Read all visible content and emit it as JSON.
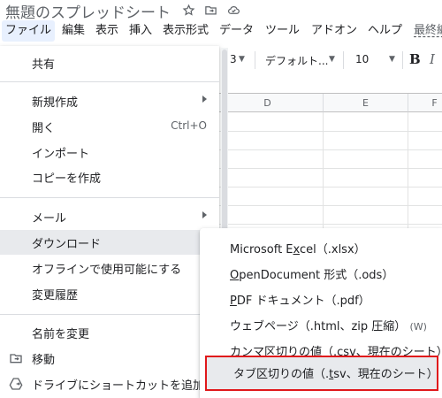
{
  "title": {
    "doc_title": "無題のスプレッドシート",
    "icons": [
      "star-icon",
      "move-folder-icon",
      "cloud-status-icon"
    ]
  },
  "menubar": {
    "items": [
      {
        "label": "ファイル",
        "active": true
      },
      {
        "label": "編集"
      },
      {
        "label": "表示"
      },
      {
        "label": "挿入"
      },
      {
        "label": "表示形式"
      },
      {
        "label": "データ"
      },
      {
        "label": "ツール"
      },
      {
        "label": "アドオン"
      },
      {
        "label": "ヘルプ"
      },
      {
        "label": "最終編"
      }
    ]
  },
  "toolbar": {
    "fragment": "3",
    "font": "デフォルト...",
    "font_size": "10",
    "bold": "B",
    "italic": "I"
  },
  "grid": {
    "columns": [
      "D",
      "E",
      "F"
    ]
  },
  "file_menu": {
    "items": [
      {
        "label": "共有"
      },
      {
        "label": "新規作成",
        "submenu": true
      },
      {
        "label": "開く",
        "shortcut": "Ctrl+O"
      },
      {
        "label": "インポート"
      },
      {
        "label": "コピーを作成"
      },
      {
        "label": "メール",
        "submenu": true
      },
      {
        "label": "ダウンロード",
        "submenu": true,
        "hover": true
      },
      {
        "label": "オフラインで使用可能にする"
      },
      {
        "label": "変更履歴",
        "submenu": true
      },
      {
        "label": "名前を変更"
      },
      {
        "label": "移動",
        "icon": "move-folder-icon"
      },
      {
        "label": "ドライブにショートカットを追加",
        "icon": "drive-shortcut-icon"
      }
    ]
  },
  "download_menu": {
    "items": [
      {
        "pre": "Microsoft E",
        "u": "x",
        "post": "cel（.xlsx）"
      },
      {
        "pre": "",
        "u": "O",
        "post": "penDocument 形式（.ods）"
      },
      {
        "pre": "",
        "u": "P",
        "post": "DF ドキュメント（.pdf）"
      },
      {
        "pre": "ウェブページ（.html、zip 圧縮）",
        "u": "",
        "post": "",
        "sub": "(W)"
      },
      {
        "pre": "カンマ区切りの値（.",
        "u": "c",
        "post": "sv、現在のシート）"
      },
      {
        "pre": "タブ区切りの値（.",
        "u": "t",
        "post": "sv、現在のシート）",
        "highlighted": true
      }
    ],
    "highlight_color": "#e0181b"
  }
}
